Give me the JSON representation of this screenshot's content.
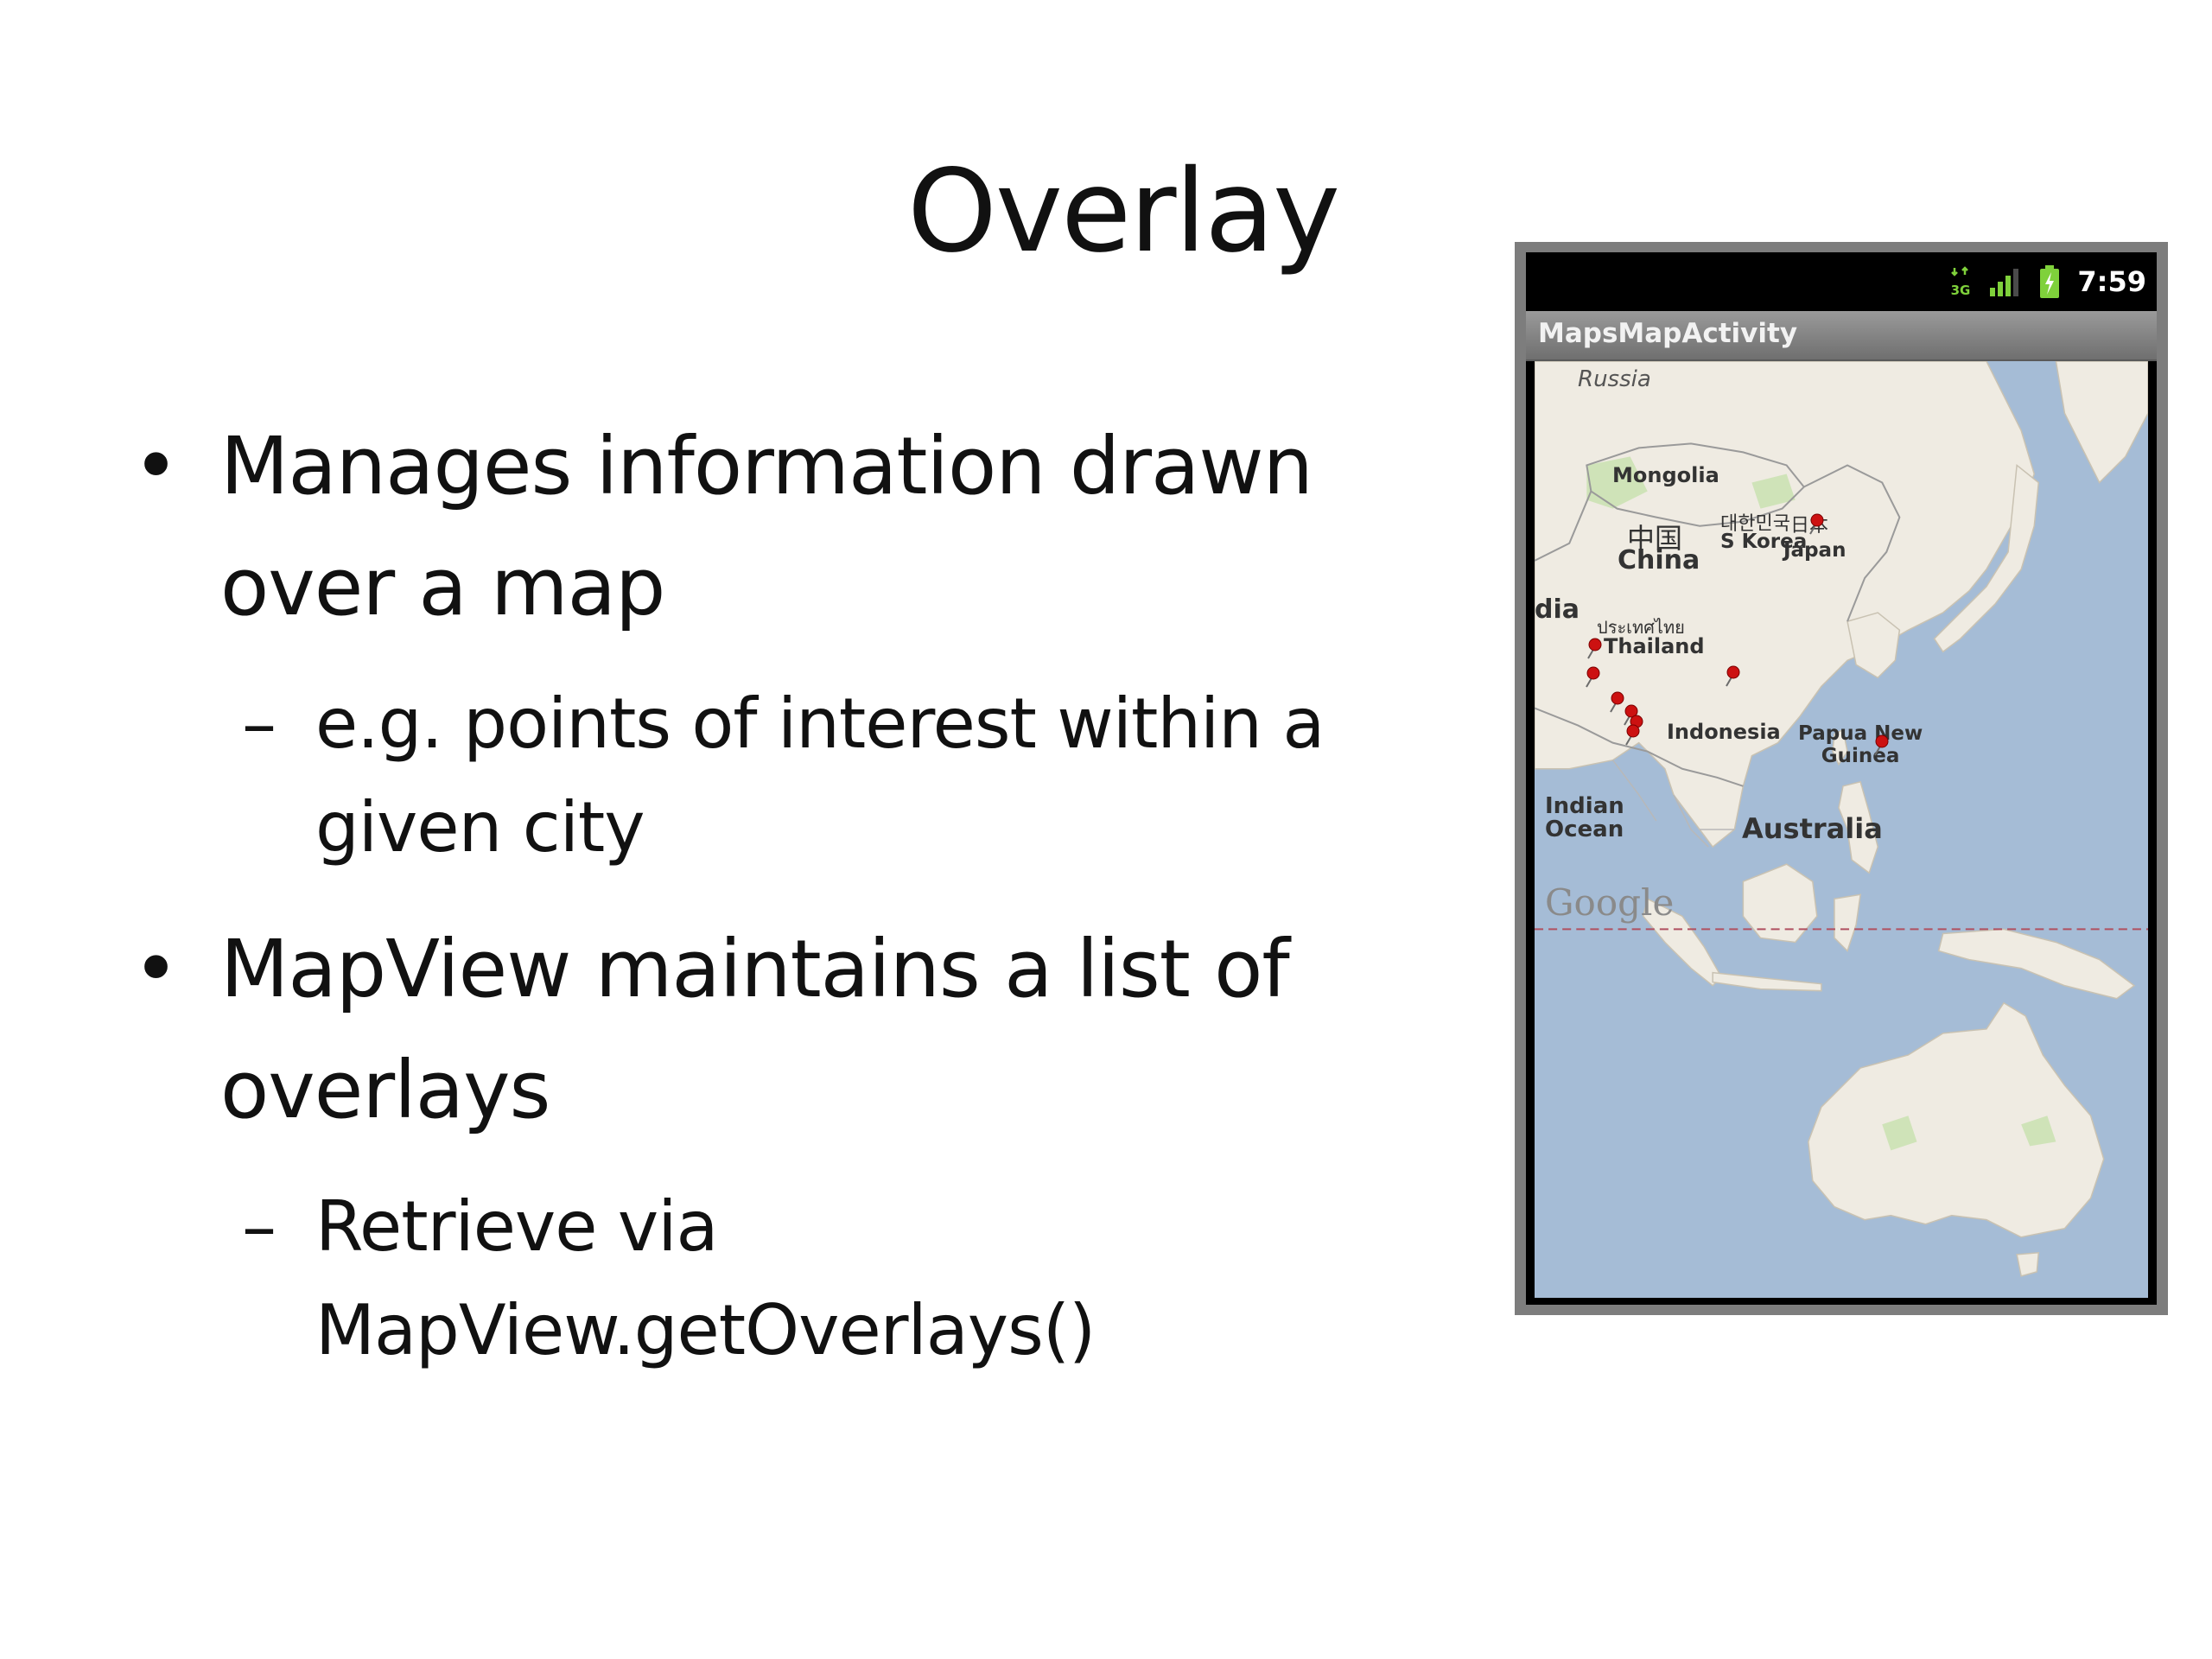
{
  "slide": {
    "title": "Overlay",
    "bullets": [
      {
        "lines": [
          "Manages information drawn",
          "over a map"
        ],
        "sub": [
          "e.g. points of interest within a",
          "given city"
        ]
      },
      {
        "lines": [
          "MapView maintains a list of",
          "overlays"
        ],
        "sub": [
          "Retrieve via",
          "MapView.getOverlays()"
        ]
      }
    ],
    "bullet_glyph": "•",
    "sub_glyph": "–"
  },
  "phone": {
    "status": {
      "network": "3G",
      "time": "7:59",
      "icons": [
        "network-3g-icon",
        "signal-bars-icon",
        "battery-charging-icon"
      ]
    },
    "app_title": "MapsMapActivity",
    "map": {
      "labels": {
        "russia": "Russia",
        "mongolia": "Mongolia",
        "china_native": "中国",
        "china": "China",
        "korea_native": "대한민국",
        "korea": "S Korea",
        "japan_native": "日本",
        "japan": "Japan",
        "india_fragment": "dia",
        "thailand_native": "ประเทศไทย",
        "thailand": "Thailand",
        "indonesia": "Indonesia",
        "png_line1": "Papua New",
        "png_line2": "Guinea",
        "indian_ocean_line1": "Indian",
        "indian_ocean_line2": "Ocean",
        "australia": "Australia",
        "google": "Google"
      },
      "colors": {
        "water": "#a5bcd6",
        "land": "#efebe2",
        "park": "#cfe3b8",
        "border": "#9a9a9a",
        "pin": "#cc1111",
        "equator": "#b05060"
      },
      "marker_count": 9
    }
  }
}
